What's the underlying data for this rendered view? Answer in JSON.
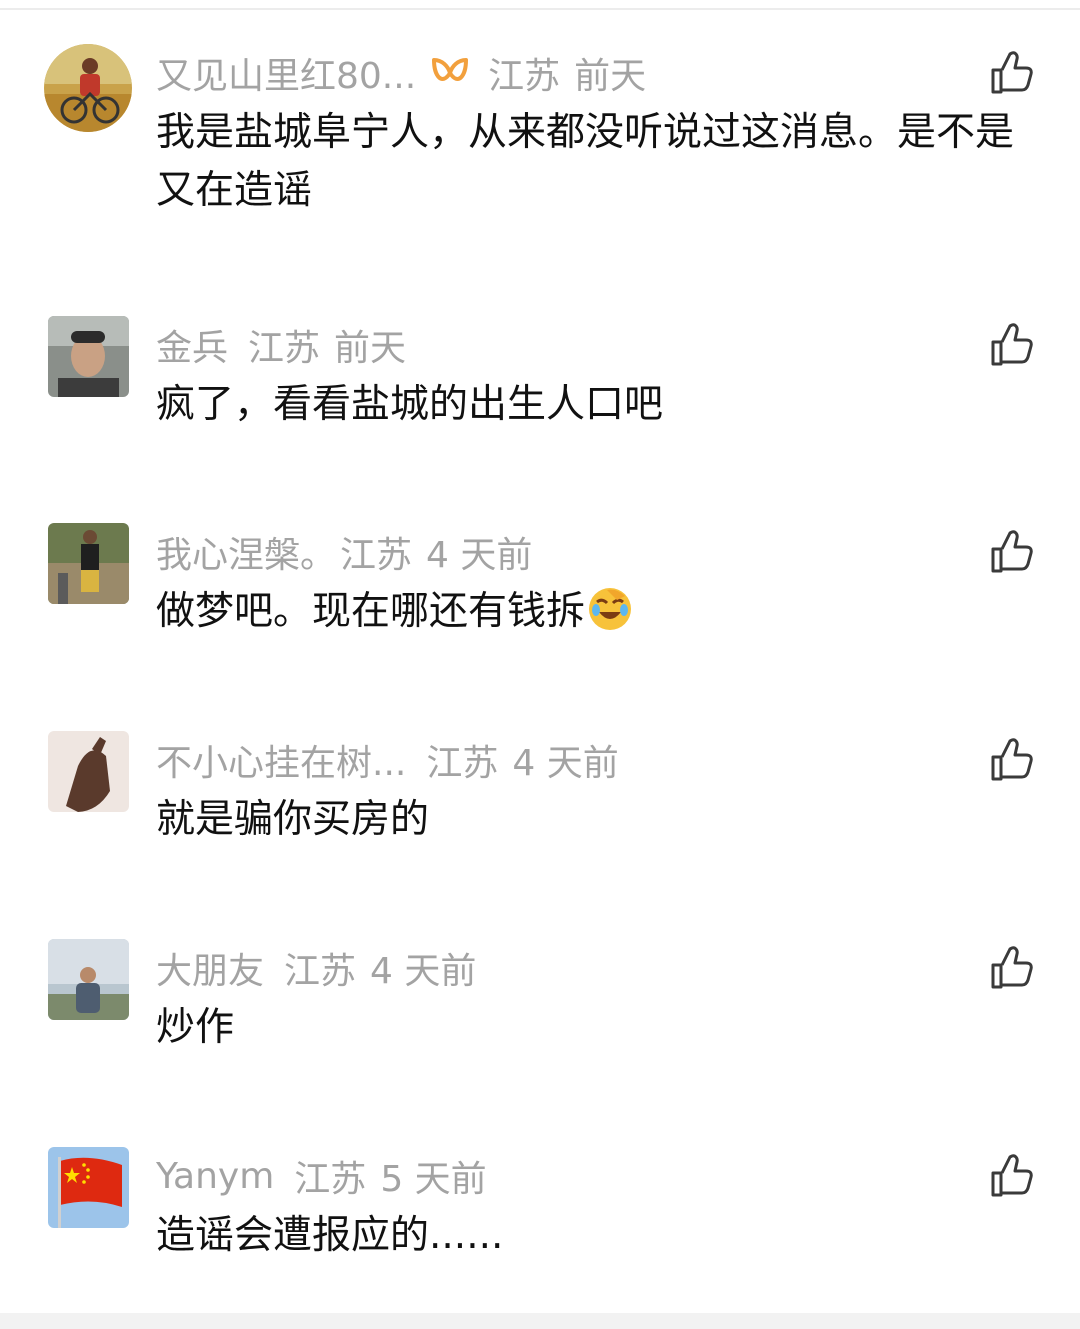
{
  "colors": {
    "meta": "#a3a3a3",
    "text": "#111111",
    "vip_badge": "#f2a03d"
  },
  "icons": {
    "like": "thumbs-up-icon",
    "vip": "vip-badge-icon",
    "emoji": "facepalm-laugh-emoji"
  },
  "comments": [
    {
      "name": "又见山里红80...",
      "region": "江苏",
      "time": "前天",
      "text": "我是盐城阜宁人，从来都没听说过这消息。是不是又在造谣"
    },
    {
      "name": "金兵",
      "region": "江苏",
      "time": "前天",
      "text": "疯了，看看盐城的出生人口吧"
    },
    {
      "name": "我心涅槃。",
      "region": "江苏",
      "time": "4 天前",
      "text": "做梦吧。现在哪还有钱拆"
    },
    {
      "name": "不小心挂在树...",
      "region": "江苏",
      "time": "4 天前",
      "text": "就是骗你买房的"
    },
    {
      "name": "大朋友",
      "region": "江苏",
      "time": "4 天前",
      "text": "炒作"
    },
    {
      "name": "Yanym",
      "region": "江苏",
      "time": "5 天前",
      "text": "造谣会遭报应的......"
    }
  ]
}
